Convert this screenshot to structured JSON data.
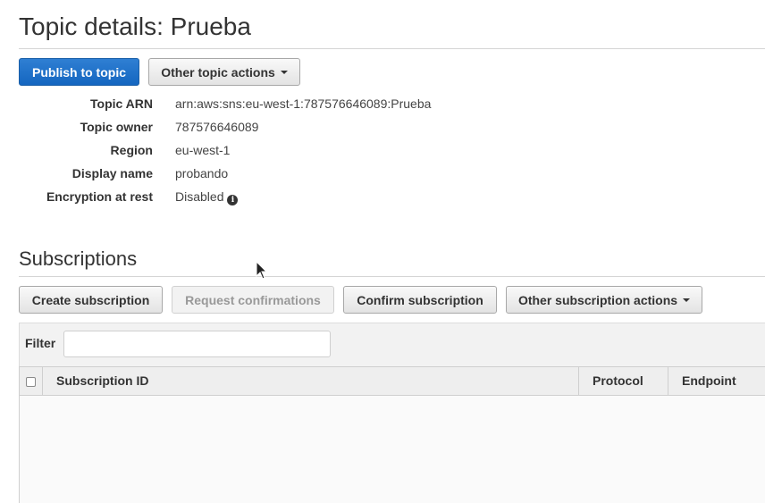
{
  "header": {
    "title": "Topic details: Prueba"
  },
  "topic_actions": {
    "publish_label": "Publish to topic",
    "other_label": "Other topic actions"
  },
  "details": [
    {
      "label": "Topic ARN",
      "value": "arn:aws:sns:eu-west-1:787576646089:Prueba"
    },
    {
      "label": "Topic owner",
      "value": "787576646089"
    },
    {
      "label": "Region",
      "value": "eu-west-1"
    },
    {
      "label": "Display name",
      "value": "probando"
    },
    {
      "label": "Encryption at rest",
      "value": "Disabled"
    }
  ],
  "subscriptions": {
    "title": "Subscriptions",
    "create_label": "Create subscription",
    "request_label": "Request confirmations",
    "confirm_label": "Confirm subscription",
    "other_label": "Other subscription actions",
    "filter_label": "Filter",
    "filter_value": "",
    "columns": [
      "Subscription ID",
      "Protocol",
      "Endpoint"
    ]
  },
  "colors": {
    "primary": "#1a6fcf",
    "border": "#a8a8a8"
  }
}
